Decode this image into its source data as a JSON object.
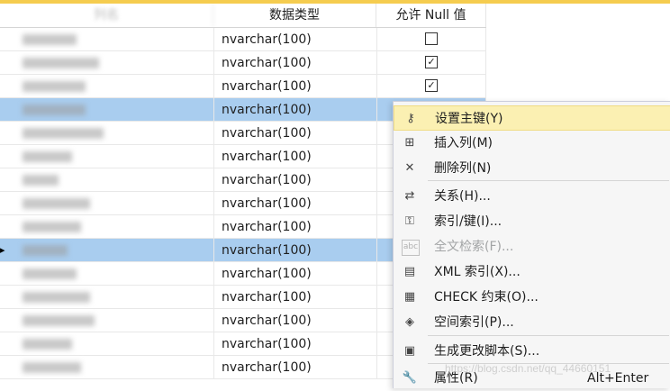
{
  "header": {
    "col_name": "列名",
    "col_type": "数据类型",
    "col_null": "允许 Null 值"
  },
  "rows": [
    {
      "type": "nvarchar(100)",
      "null": "unchecked",
      "selected": false
    },
    {
      "type": "nvarchar(100)",
      "null": "checked",
      "selected": false
    },
    {
      "type": "nvarchar(100)",
      "null": "checked",
      "selected": false
    },
    {
      "type": "nvarchar(100)",
      "null": "",
      "selected": true
    },
    {
      "type": "nvarchar(100)",
      "null": "",
      "selected": false
    },
    {
      "type": "nvarchar(100)",
      "null": "",
      "selected": false
    },
    {
      "type": "nvarchar(100)",
      "null": "",
      "selected": false
    },
    {
      "type": "nvarchar(100)",
      "null": "",
      "selected": false
    },
    {
      "type": "nvarchar(100)",
      "null": "",
      "selected": false
    },
    {
      "type": "nvarchar(100)",
      "null": "",
      "selected": true,
      "current": true
    },
    {
      "type": "nvarchar(100)",
      "null": "",
      "selected": false
    },
    {
      "type": "nvarchar(100)",
      "null": "",
      "selected": false
    },
    {
      "type": "nvarchar(100)",
      "null": "",
      "selected": false
    },
    {
      "type": "nvarchar(100)",
      "null": "",
      "selected": false
    },
    {
      "type": "nvarchar(100)",
      "null": "",
      "selected": false
    }
  ],
  "context_menu": {
    "items": [
      {
        "label": "设置主键(Y)",
        "icon": "key-icon",
        "glyph": "⚷",
        "enabled": true,
        "highlighted": true
      },
      {
        "label": "插入列(M)",
        "icon": "insert-column-icon",
        "glyph": "⊞",
        "enabled": true
      },
      {
        "label": "删除列(N)",
        "icon": "delete-column-icon",
        "glyph": "✕",
        "enabled": true
      },
      {
        "label": "关系(H)...",
        "icon": "relationship-icon",
        "glyph": "⇄",
        "enabled": true
      },
      {
        "label": "索引/键(I)...",
        "icon": "index-key-icon",
        "glyph": "⚿",
        "enabled": true
      },
      {
        "label": "全文检索(F)...",
        "icon": "fulltext-icon",
        "glyph": "abc",
        "enabled": false
      },
      {
        "label": "XML 索引(X)...",
        "icon": "xml-index-icon",
        "glyph": "▤",
        "enabled": true
      },
      {
        "label": "CHECK 约束(O)...",
        "icon": "check-constraint-icon",
        "glyph": "▦",
        "enabled": true
      },
      {
        "label": "空间索引(P)...",
        "icon": "spatial-index-icon",
        "glyph": "◈",
        "enabled": true
      },
      {
        "label": "生成更改脚本(S)...",
        "icon": "generate-script-icon",
        "glyph": "▣",
        "enabled": true
      },
      {
        "label": "属性(R)",
        "icon": "properties-wrench-icon",
        "glyph": "🔧",
        "enabled": true,
        "shortcut": "Alt+Enter"
      }
    ]
  },
  "watermark": "https://blog.csdn.net/qq_44660151",
  "colors": {
    "selection": "#a9cdef",
    "menu_highlight": "#fbf0b2",
    "accent_bar": "#f5cc4f"
  }
}
